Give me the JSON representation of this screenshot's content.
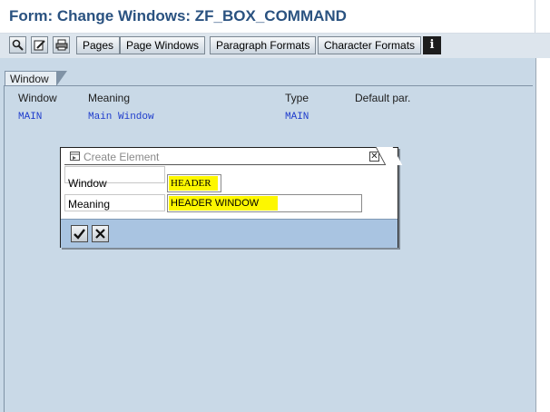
{
  "title": "Form: Change Windows: ZF_BOX_COMMAND",
  "toolbar": {
    "buttons": [
      "Pages",
      "Page Windows",
      "Paragraph Formats",
      "Character Formats"
    ],
    "info_label": "i"
  },
  "window_tab": "Window",
  "table": {
    "headers": [
      "Window",
      "Meaning",
      "Type",
      "Default par."
    ],
    "rows": [
      [
        "MAIN",
        "Main Window",
        "MAIN",
        ""
      ]
    ]
  },
  "dialog": {
    "title": "Create Element",
    "fields": [
      {
        "label": "Window",
        "value": "HEADER"
      },
      {
        "label": "Meaning",
        "value": "HEADER WINDOW"
      }
    ]
  },
  "colors": {
    "title_text": "#2a5280",
    "main_bg": "#c9d9e7",
    "highlight": "#fdf700",
    "cell_text": "#1e3ccc",
    "dialog_footer": "#a9c4e1"
  }
}
